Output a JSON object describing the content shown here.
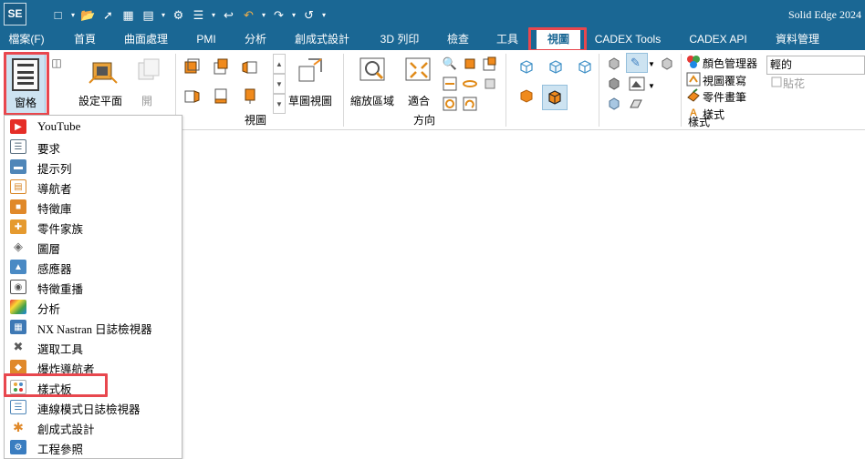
{
  "app": {
    "logo": "SE",
    "title": "Solid Edge 2024"
  },
  "qat": {
    "icons": [
      "new-icon",
      "open-icon",
      "pin-icon",
      "save-icon",
      "save-as-icon",
      "settings-icon",
      "menu-icon",
      "exit-icon",
      "undo-icon",
      "redo-icon",
      "repeat-icon",
      "customize-icon"
    ]
  },
  "menu": {
    "items": [
      {
        "label": "檔案(F)"
      },
      {
        "label": "首頁"
      },
      {
        "label": "曲面處理"
      },
      {
        "label": "PMI"
      },
      {
        "label": "分析"
      },
      {
        "label": "創成式設計"
      },
      {
        "label": "3D 列印"
      },
      {
        "label": "檢查"
      },
      {
        "label": "工具"
      },
      {
        "label": "視圖"
      },
      {
        "label": "CADEX Tools"
      },
      {
        "label": "CADEX API"
      },
      {
        "label": "資料管理"
      }
    ],
    "active": "視圖"
  },
  "ribbon": {
    "window_label": "窗格",
    "set_plane_label": "設定平面",
    "open_label": "開",
    "sketch_view_label": "草圖視圖",
    "views_group": "視圖",
    "zoom_area_label": "縮放區域",
    "fit_label": "適合",
    "orient_group": "方向",
    "color_manager_label": "顏色管理器",
    "view_overlay_label": "視圖覆寫",
    "part_painter_label": "零件畫筆",
    "style_label": "樣式",
    "style_group": "樣式",
    "style_value": "輕的",
    "paste_label": "貼花"
  },
  "dropdown": {
    "items": [
      {
        "label": "YouTube",
        "icon": "youtube-icon",
        "color": "#e52d27"
      },
      {
        "label": "要求",
        "icon": "requirements-icon",
        "color": "#5a6f80"
      },
      {
        "label": "提示列",
        "icon": "prompt-bar-icon",
        "color": "#4f86b8"
      },
      {
        "label": "導航者",
        "icon": "navigator-icon",
        "color": "#d9892b"
      },
      {
        "label": "特徵庫",
        "icon": "feature-library-icon",
        "color": "#e0892a"
      },
      {
        "label": "零件家族",
        "icon": "part-family-icon",
        "color": "#e59a2f"
      },
      {
        "label": "圖層",
        "icon": "layers-icon",
        "color": "#6b6b6b"
      },
      {
        "label": "感應器",
        "icon": "sensor-icon",
        "color": "#4a8ac4"
      },
      {
        "label": "特徵重播",
        "icon": "feature-playback-icon",
        "color": "#555555"
      },
      {
        "label": "分析",
        "icon": "analysis-icon",
        "color": "#3e79b5"
      },
      {
        "label": "NX Nastran 日誌檢視器",
        "icon": "nastran-log-icon",
        "color": "#3e79b5"
      },
      {
        "label": "選取工具",
        "icon": "select-tool-icon",
        "color": "#5a5a5a"
      },
      {
        "label": "爆炸導航者",
        "icon": "explode-navigator-icon",
        "color": "#e0892a"
      },
      {
        "label": "樣式板",
        "icon": "style-board-icon",
        "color": "#e8a73a"
      },
      {
        "label": "連線模式日誌檢視器",
        "icon": "connection-log-icon",
        "color": "#4f86b8"
      },
      {
        "label": "創成式設計",
        "icon": "generative-design-icon",
        "color": "#e0892a"
      },
      {
        "label": "工程參照",
        "icon": "engineering-reference-icon",
        "color": "#3a7dc0"
      }
    ],
    "highlighted": "樣式板"
  },
  "colors": {
    "titlebar": "#1a6794",
    "highlight": "#e8474e",
    "accent_orange": "#f08a1c"
  }
}
